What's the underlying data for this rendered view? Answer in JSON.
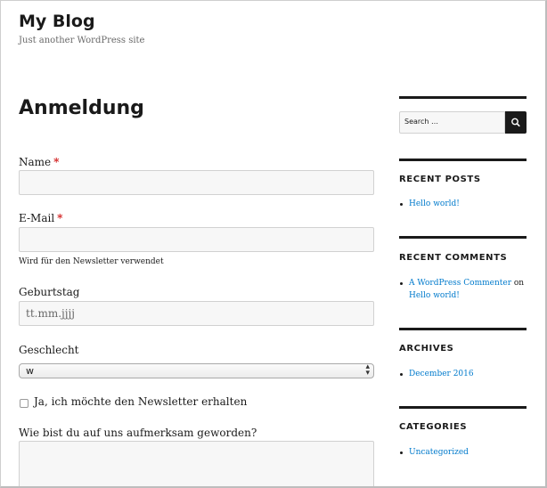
{
  "site": {
    "title": "My Blog",
    "description": "Just another WordPress site"
  },
  "main": {
    "page_title": "Anmeldung",
    "form": {
      "name_label": "Name",
      "email_label": "E-Mail",
      "required_mark": "*",
      "email_hint": "Wird für den Newsletter verwendet",
      "birthday_label": "Geburtstag",
      "birthday_placeholder": "tt.mm.jjjj",
      "gender_label": "Geschlecht",
      "gender_selected": "w",
      "newsletter_checkbox_label": "Ja, ich möchte den Newsletter erhalten",
      "newsletter_checked": false,
      "source_label": "Wie bist du auf uns aufmerksam geworden?"
    }
  },
  "sidebar": {
    "search": {
      "placeholder": "Search …"
    },
    "recent_posts": {
      "title": "RECENT POSTS",
      "items": [
        "Hello world!"
      ]
    },
    "recent_comments": {
      "title": "RECENT COMMENTS",
      "items": [
        {
          "author": "A WordPress Commenter",
          "connector": "on",
          "post": "Hello world!"
        }
      ]
    },
    "archives": {
      "title": "ARCHIVES",
      "items": [
        "December 2016"
      ]
    },
    "categories": {
      "title": "CATEGORIES",
      "items": [
        "Uncategorized"
      ]
    }
  },
  "colors": {
    "link": "#007acc",
    "required": "#d11c1c",
    "text": "#1a1a1a",
    "field_bg": "#f7f7f7"
  }
}
